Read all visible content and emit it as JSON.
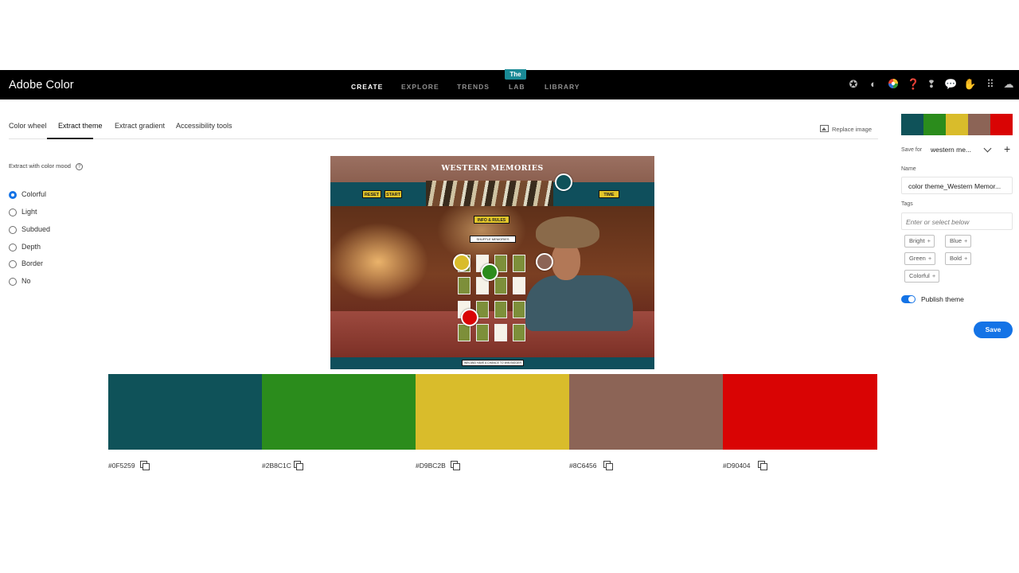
{
  "header": {
    "brand": "Adobe Color",
    "nav": [
      {
        "label": "CREATE",
        "active": true
      },
      {
        "label": "EXPLORE",
        "active": false
      },
      {
        "label": "TRENDS",
        "active": false
      },
      {
        "label": "LAB",
        "active": false,
        "badge": "The"
      },
      {
        "label": "LIBRARY",
        "active": false
      }
    ],
    "icons": [
      "cc-badge-icon",
      "contrast-icon",
      "color-wheel-icon",
      "help-icon",
      "alert-icon",
      "feedback-icon",
      "hand-icon",
      "apps-grid-icon",
      "creative-cloud-icon"
    ]
  },
  "tabs": [
    {
      "label": "Color wheel",
      "active": false
    },
    {
      "label": "Extract theme",
      "active": true
    },
    {
      "label": "Extract gradient",
      "active": false
    },
    {
      "label": "Accessibility tools",
      "active": false
    }
  ],
  "replace_image": "Replace image",
  "mood": {
    "title": "Extract with color mood",
    "options": [
      {
        "label": "Colorful",
        "checked": true
      },
      {
        "label": "Light",
        "checked": false
      },
      {
        "label": "Subdued",
        "checked": false
      },
      {
        "label": "Depth",
        "checked": false
      },
      {
        "label": "Border",
        "checked": false
      },
      {
        "label": "No",
        "checked": false
      }
    ]
  },
  "image": {
    "title": "WESTERN MEMORIES",
    "buttons": [
      "RESET",
      "START",
      "TIME"
    ],
    "info": "INFO & RULES",
    "shuffle": "SHUFFLE MEMORIES",
    "footer": "WIN AND HAVE A CHANCE TO WIN BIGGER"
  },
  "swatches": [
    {
      "hex": "#0F5259",
      "color": "#0F5259"
    },
    {
      "hex": "#2B8C1C",
      "color": "#2B8C1C"
    },
    {
      "hex": "#D9BC2B",
      "color": "#D9BC2B"
    },
    {
      "hex": "#8C6456",
      "color": "#8C6456"
    },
    {
      "hex": "#D90404",
      "color": "#D90404"
    }
  ],
  "panel": {
    "save_for_label": "Save for",
    "save_for_value": "western me...",
    "name_label": "Name",
    "name_value": "color theme_Western Memor...",
    "tags_label": "Tags",
    "tags_placeholder": "Enter or select below",
    "tags": [
      "Bright",
      "Blue",
      "Green",
      "Bold",
      "Colorful"
    ],
    "publish_label": "Publish theme",
    "publish_on": true,
    "save_label": "Save"
  }
}
